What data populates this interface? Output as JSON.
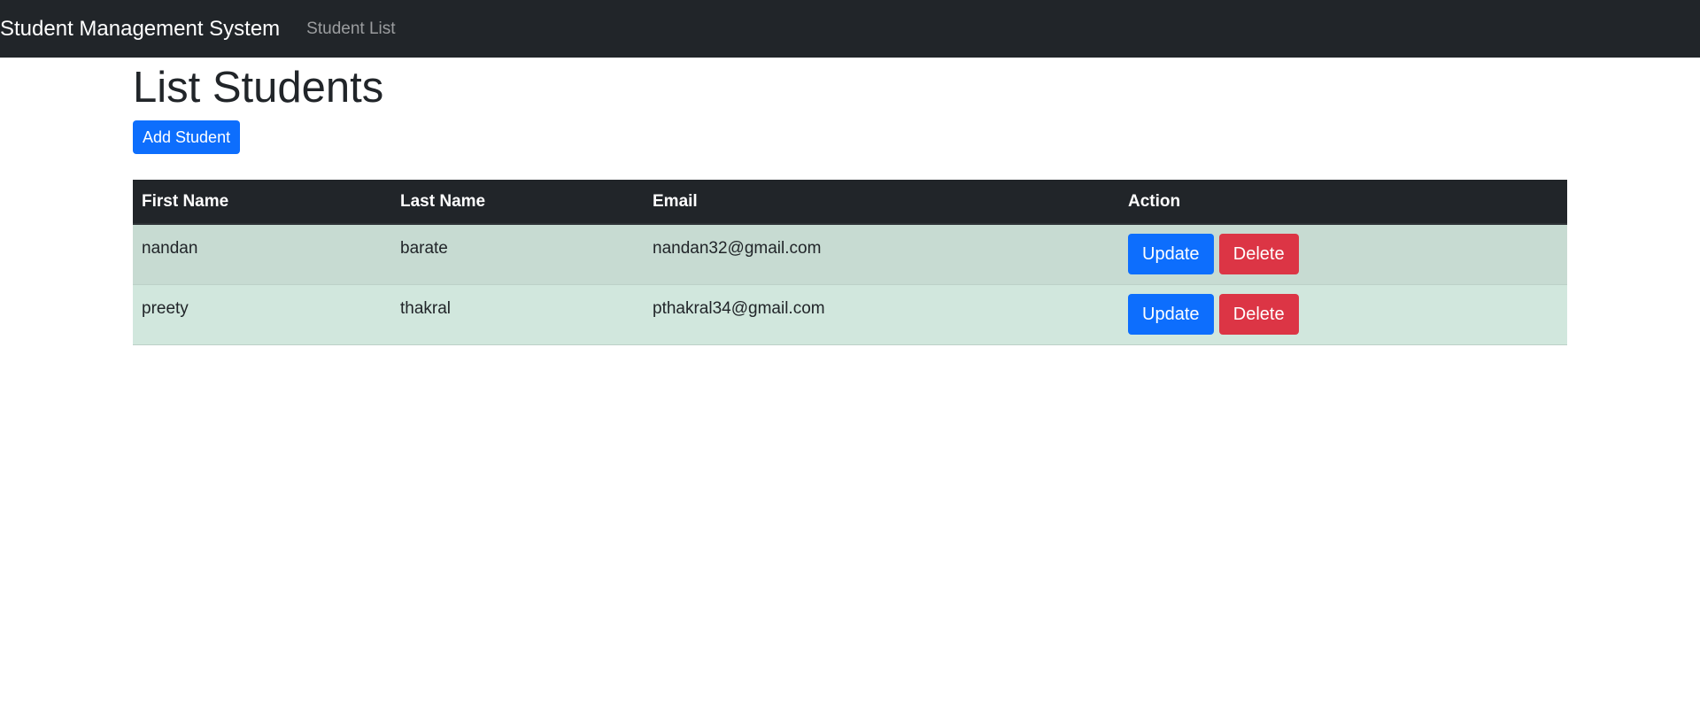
{
  "navbar": {
    "brand": "Student Management System",
    "links": [
      "Student List"
    ]
  },
  "page": {
    "title": "List Students",
    "add_button": "Add Student"
  },
  "table": {
    "headers": [
      "First Name",
      "Last Name",
      "Email",
      "Action"
    ],
    "rows": [
      {
        "first_name": "nandan",
        "last_name": "barate",
        "email": "nandan32@gmail.com",
        "update": "Update",
        "delete": "Delete"
      },
      {
        "first_name": "preety",
        "last_name": "thakral",
        "email": "pthakral34@gmail.com",
        "update": "Update",
        "delete": "Delete"
      }
    ]
  },
  "colors": {
    "navbar": "#212529",
    "primary": "#0d6efd",
    "danger": "#dc3545",
    "row_success": "#d1e7dd"
  }
}
